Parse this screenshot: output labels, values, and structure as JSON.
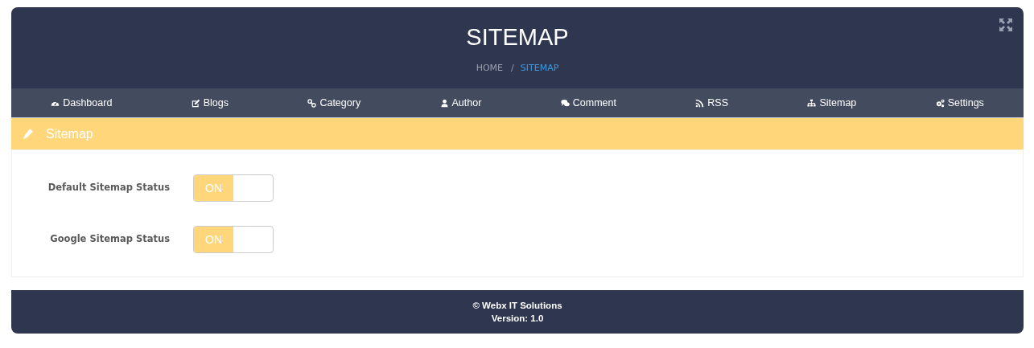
{
  "header": {
    "title": "SITEMAP",
    "breadcrumb_separator": "/",
    "breadcrumb": [
      {
        "label": "HOME",
        "selected": false
      },
      {
        "label": "SITEMAP",
        "selected": true
      }
    ]
  },
  "nav": [
    {
      "label": "Dashboard",
      "kind": "dashboard"
    },
    {
      "label": "Blogs",
      "kind": "edit"
    },
    {
      "label": "Category",
      "kind": "link"
    },
    {
      "label": "Author",
      "kind": "user"
    },
    {
      "label": "Comment",
      "kind": "comment"
    },
    {
      "label": "RSS",
      "kind": "rss"
    },
    {
      "label": "Sitemap",
      "kind": "sitemap"
    },
    {
      "label": "Settings",
      "kind": "gears"
    }
  ],
  "panel": {
    "title": "Sitemap",
    "fields": [
      {
        "label": "Default Sitemap Status",
        "on": true,
        "state_label": "ON"
      },
      {
        "label": "Google Sitemap Status",
        "on": true,
        "state_label": "ON"
      }
    ]
  },
  "footer": {
    "copyright": "© Webx IT Solutions",
    "version": "Version: 1.0"
  }
}
